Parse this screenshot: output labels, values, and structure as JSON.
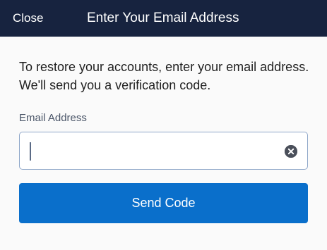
{
  "header": {
    "close_label": "Close",
    "title": "Enter Your Email Address"
  },
  "main": {
    "instructions": "To restore your accounts, enter your email address. We'll send you a verification code.",
    "email_label": "Email Address",
    "email_value": "",
    "email_placeholder": "",
    "clear_icon": "clear-circle-x-icon",
    "send_label": "Send Code"
  },
  "colors": {
    "header_bg": "#17233f",
    "primary_button": "#0a6fcb",
    "input_border": "#8fa7c9"
  }
}
